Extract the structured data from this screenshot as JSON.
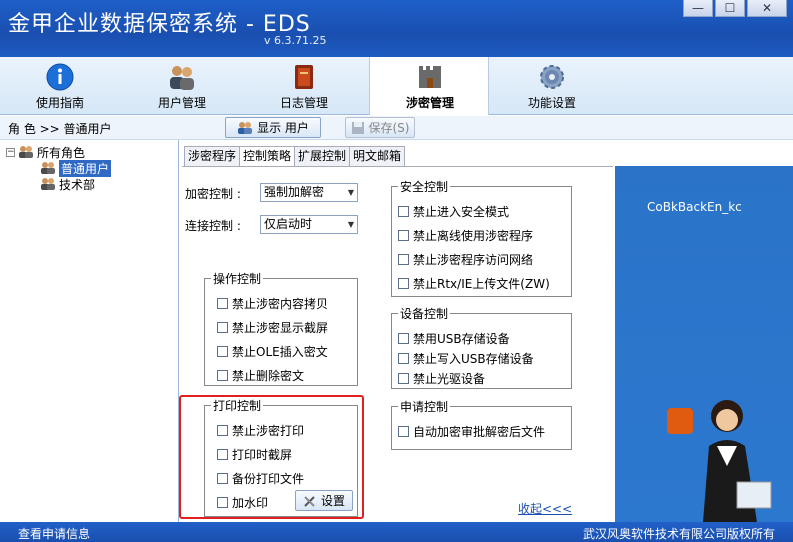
{
  "window": {
    "title": "金甲企业数据保密系统 - EDS",
    "version": "v 6.3.71.25",
    "controls": [
      "minimize",
      "maximize",
      "close"
    ]
  },
  "toolbar": {
    "items": [
      {
        "label": "使用指南",
        "icon": "info-icon"
      },
      {
        "label": "用户管理",
        "icon": "users-icon"
      },
      {
        "label": "日志管理",
        "icon": "log-book-icon"
      },
      {
        "label": "涉密管理",
        "icon": "castle-icon",
        "active": true
      },
      {
        "label": "功能设置",
        "icon": "gear-icon"
      }
    ]
  },
  "subbar": {
    "breadcrumb": "角 色 >> 普通用户",
    "show_users": "显示 用户",
    "save": "保存(S)"
  },
  "tree": {
    "root": "所有角色",
    "children": [
      "普通用户",
      "技术部"
    ]
  },
  "tabs": [
    "涉密程序",
    "控制策略",
    "扩展控制",
    "明文邮箱"
  ],
  "policy": {
    "encrypt_label": "加密控制 :",
    "encrypt_value": "强制加解密",
    "connect_label": "连接控制 :",
    "connect_value": "仅启动时"
  },
  "groups": {
    "operation": {
      "title": "操作控制",
      "items": [
        "禁止涉密内容拷贝",
        "禁止涉密显示截屏",
        "禁止OLE插入密文",
        "禁止删除密文"
      ]
    },
    "print": {
      "title": "打印控制",
      "items": [
        "禁止涉密打印",
        "打印时截屏",
        "备份打印文件",
        "加水印"
      ],
      "settings": "设置"
    },
    "security": {
      "title": "安全控制",
      "items": [
        "禁止进入安全模式",
        "禁止离线使用涉密程序",
        "禁止涉密程序访问网络",
        "禁止Rtx/IE上传文件(ZW)"
      ]
    },
    "device": {
      "title": "设备控制",
      "items": [
        "禁用USB存储设备",
        "禁止写入USB存储设备",
        "禁止光驱设备"
      ]
    },
    "request": {
      "title": "申请控制",
      "items": [
        "自动加密审批解密后文件"
      ]
    }
  },
  "collapse": "收起<<<",
  "ad_text": "CoBkBackEn_kc",
  "status": {
    "left": "查看申请信息",
    "right": "武汉风奥软件技术有限公司版权所有"
  }
}
